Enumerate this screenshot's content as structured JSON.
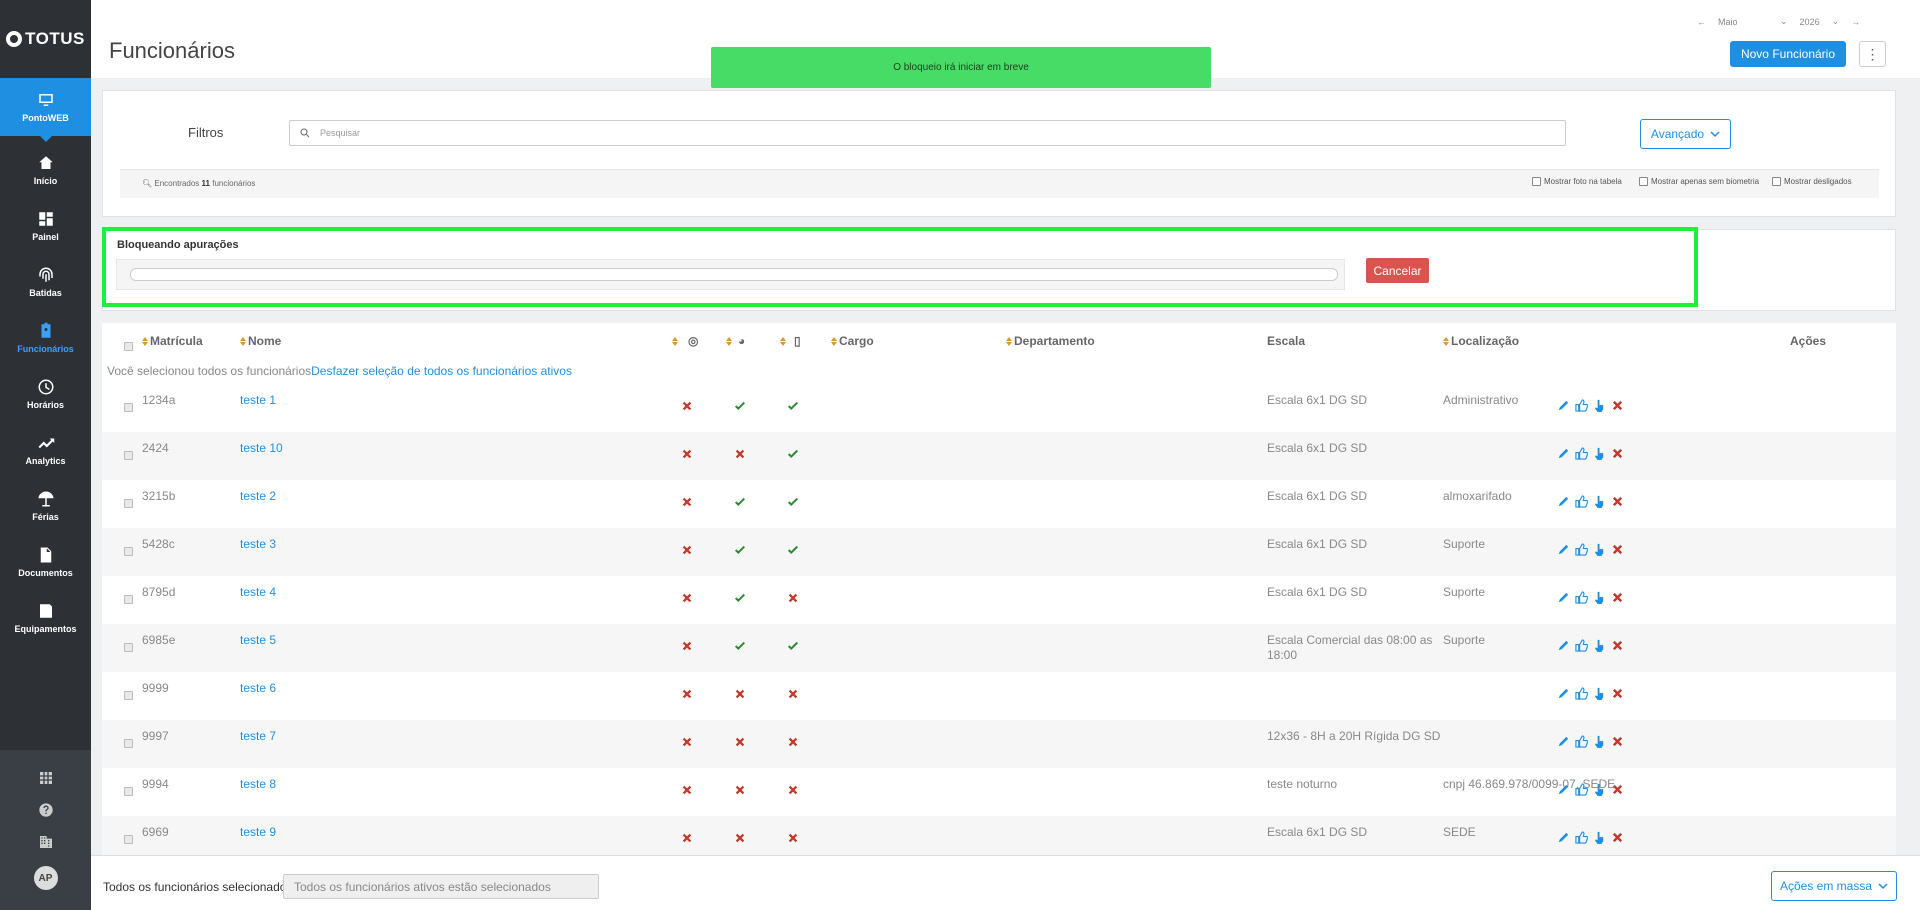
{
  "app": {
    "logo": "TOTUS",
    "page_title": "Funcionários"
  },
  "sidebar": {
    "items": [
      {
        "label": "PontoWEB",
        "icon": "monitor-icon"
      },
      {
        "label": "Início",
        "icon": "home-icon"
      },
      {
        "label": "Painel",
        "icon": "dashboard-icon"
      },
      {
        "label": "Batidas",
        "icon": "fingerprint-icon"
      },
      {
        "label": "Funcionários",
        "icon": "badge-icon"
      },
      {
        "label": "Horários",
        "icon": "clock-icon"
      },
      {
        "label": "Analytics",
        "icon": "trend-icon"
      },
      {
        "label": "Férias",
        "icon": "umbrella-icon"
      },
      {
        "label": "Documentos",
        "icon": "document-icon"
      },
      {
        "label": "Equipamentos",
        "icon": "device-icon"
      }
    ],
    "bottom": {
      "avatar": "AP"
    }
  },
  "header": {
    "month": "Maio",
    "year": "2026",
    "new_button": "Novo Funcionário",
    "toast": "O bloqueio irá iniciar em breve"
  },
  "filters": {
    "label": "Filtros",
    "search_placeholder": "Pesquisar",
    "search_value": "",
    "advanced": "Avançado",
    "found_prefix": "Encontrados",
    "found_count": "11",
    "found_suffix": "funcionários",
    "show_photo": "Mostrar foto na tabela",
    "show_no_bio": "Mostrar apenas sem biometria",
    "show_dismissed": "Mostrar desligados"
  },
  "block": {
    "title": "Bloqueando apurações",
    "progress": 0,
    "cancel": "Cancelar"
  },
  "table": {
    "headers": {
      "matricula": "Matrícula",
      "nome": "Nome",
      "cargo": "Cargo",
      "departamento": "Departamento",
      "escala": "Escala",
      "localizacao": "Localização",
      "acoes": "Ações"
    },
    "selection_note": "Você selecionou todos os funcionários",
    "selection_link": "Desfazer seleção de todos os funcionários ativos",
    "rows": [
      {
        "matricula": "1234a",
        "nome": "teste 1",
        "bio": false,
        "web": true,
        "mobile": true,
        "escala": "Escala 6x1 DG SD",
        "escala2": "",
        "local": "Administrativo"
      },
      {
        "matricula": "2424",
        "nome": "teste 10",
        "bio": false,
        "web": false,
        "mobile": true,
        "escala": "Escala 6x1 DG SD",
        "escala2": "",
        "local": ""
      },
      {
        "matricula": "3215b",
        "nome": "teste 2",
        "bio": false,
        "web": true,
        "mobile": true,
        "escala": "Escala 6x1 DG SD",
        "escala2": "",
        "local": "almoxarifado"
      },
      {
        "matricula": "5428c",
        "nome": "teste 3",
        "bio": false,
        "web": true,
        "mobile": true,
        "escala": "Escala 6x1 DG SD",
        "escala2": "",
        "local": "Suporte"
      },
      {
        "matricula": "8795d",
        "nome": "teste 4",
        "bio": false,
        "web": true,
        "mobile": false,
        "escala": "Escala 6x1 DG SD",
        "escala2": "",
        "local": "Suporte"
      },
      {
        "matricula": "6985e",
        "nome": "teste 5",
        "bio": false,
        "web": true,
        "mobile": true,
        "escala": "Escala Comercial das 08:00 as",
        "escala2": "18:00",
        "local": "Suporte"
      },
      {
        "matricula": "9999",
        "nome": "teste 6",
        "bio": false,
        "web": false,
        "mobile": false,
        "escala": "",
        "escala2": "",
        "local": ""
      },
      {
        "matricula": "9997",
        "nome": "teste 7",
        "bio": false,
        "web": false,
        "mobile": false,
        "escala": "12x36 - 8H a 20H Rígida DG SD",
        "escala2": "",
        "local": ""
      },
      {
        "matricula": "9994",
        "nome": "teste 8",
        "bio": false,
        "web": false,
        "mobile": false,
        "escala": "teste noturno",
        "escala2": "",
        "local": "cnpj 46.869.978/0099-07, SEDE"
      },
      {
        "matricula": "6969",
        "nome": "teste 9",
        "bio": false,
        "web": false,
        "mobile": false,
        "escala": "Escala 6x1 DG SD",
        "escala2": "",
        "local": "SEDE"
      }
    ]
  },
  "footer": {
    "label": "Todos os funcionários selecionados",
    "field_value": "Todos os funcionários ativos estão selecionados",
    "mass_button": "Ações em massa"
  },
  "colors": {
    "accent": "#1e8fe1",
    "toast": "#47dc66",
    "cancel": "#d9534f",
    "highlight": "#18f23e",
    "check": "#2e8b3a",
    "cross": "#c0392b"
  }
}
